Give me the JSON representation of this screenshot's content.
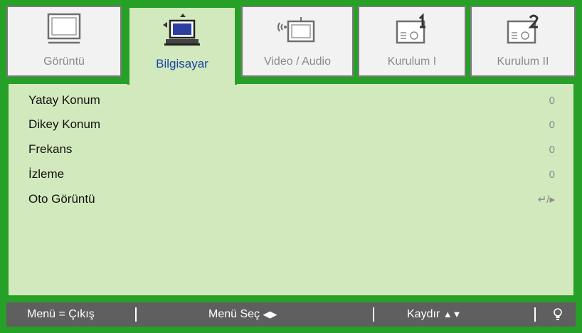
{
  "tabs": [
    {
      "label": "Görüntü",
      "icon": "monitor-icon",
      "active": false
    },
    {
      "label": "Bilgisayar",
      "icon": "computer-icon",
      "active": true
    },
    {
      "label": "Video / Audio",
      "icon": "video-audio-icon",
      "active": false
    },
    {
      "label": "Kurulum I",
      "icon": "projector-setup-1-icon",
      "active": false
    },
    {
      "label": "Kurulum II",
      "icon": "projector-setup-2-icon",
      "active": false
    }
  ],
  "menu_items": [
    {
      "label": "Yatay Konum",
      "value": "0"
    },
    {
      "label": "Dikey Konum",
      "value": "0"
    },
    {
      "label": "Frekans",
      "value": "0"
    },
    {
      "label": "İzleme",
      "value": "0"
    },
    {
      "label": "Oto Görüntü",
      "value": "↵/▸"
    }
  ],
  "footer": {
    "exit": "Menü = Çıkış",
    "select": "Menü Seç",
    "select_arrows": "◀▶",
    "scroll": "Kaydır",
    "scroll_arrows": "▲▼",
    "bulb_icon": "lamp-icon"
  },
  "colors": {
    "frame_green": "#26a026",
    "panel_bg": "#d2e9bd",
    "active_label": "#1b44a6",
    "footer_bg": "#5f5f5f"
  }
}
